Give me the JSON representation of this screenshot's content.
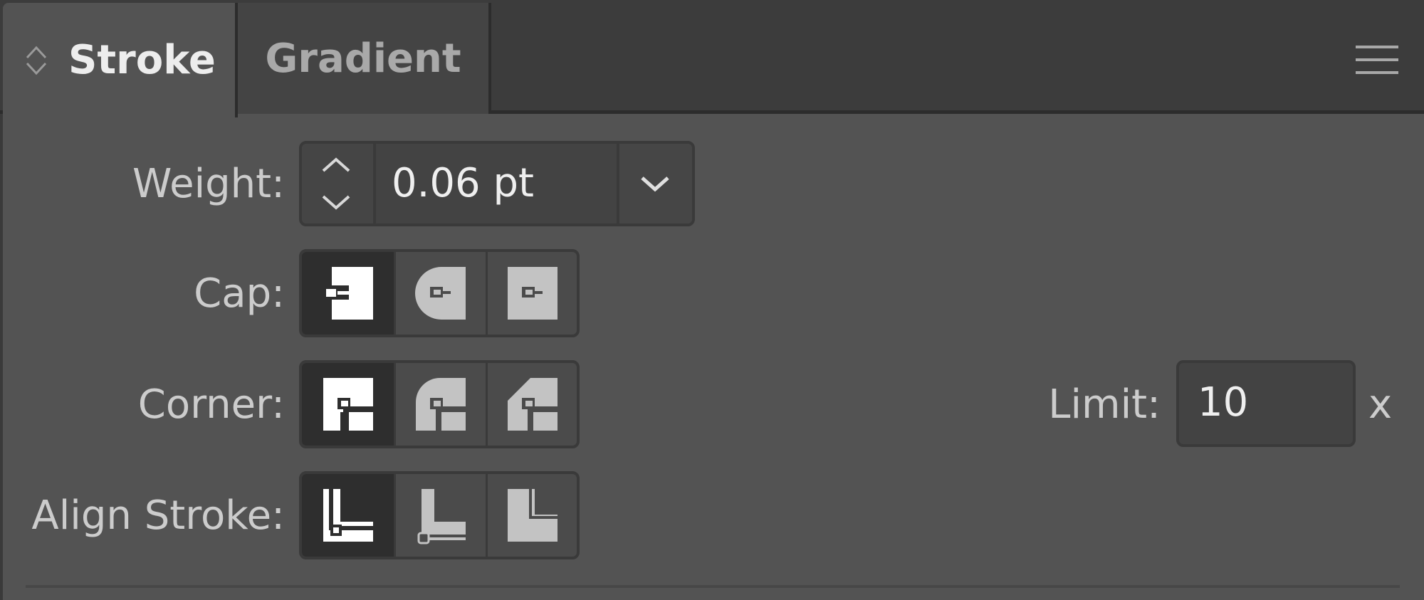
{
  "tabs": [
    {
      "label": "Stroke",
      "active": true
    },
    {
      "label": "Gradient",
      "active": false
    }
  ],
  "weight": {
    "label": "Weight:",
    "value": "0.06 pt"
  },
  "cap": {
    "label": "Cap:",
    "options": [
      "butt-cap-icon",
      "round-cap-icon",
      "projecting-cap-icon"
    ],
    "selected": 0
  },
  "corner": {
    "label": "Corner:",
    "options": [
      "miter-join-icon",
      "round-join-icon",
      "bevel-join-icon"
    ],
    "selected": 0
  },
  "limit": {
    "label": "Limit:",
    "value": "10",
    "suffix": "x"
  },
  "align_stroke": {
    "label": "Align Stroke:",
    "options": [
      "align-center-icon",
      "align-inside-icon",
      "align-outside-icon"
    ],
    "selected": 0
  },
  "colors": {
    "panel_bg": "#535353",
    "tabbar_bg": "#3c3c3c",
    "active_segment": "#2e2e2e",
    "icon_active": "#ffffff",
    "icon_inactive": "#c3c3c3"
  }
}
